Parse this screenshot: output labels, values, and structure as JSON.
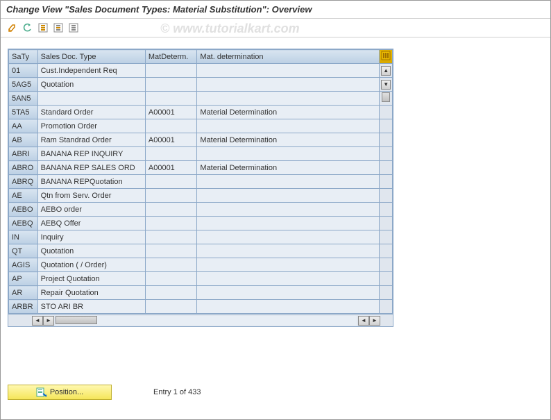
{
  "title": "Change View \"Sales Document Types: Material Substitution\": Overview",
  "watermark": "© www.tutorialkart.com",
  "columns": {
    "saty": "SaTy",
    "doctype": "Sales Doc. Type",
    "matdet": "MatDeterm.",
    "matdetdesc": "Mat. determination"
  },
  "rows": [
    {
      "saty": "01",
      "doctype": "Cust.Independent Req",
      "matdet": "",
      "matdetdesc": ""
    },
    {
      "saty": "5AG5",
      "doctype": "Quotation",
      "matdet": "",
      "matdetdesc": ""
    },
    {
      "saty": "5AN5",
      "doctype": "",
      "matdet": "",
      "matdetdesc": ""
    },
    {
      "saty": "5TA5",
      "doctype": "Standard Order",
      "matdet": "A00001",
      "matdetdesc": "Material Determination"
    },
    {
      "saty": "AA",
      "doctype": "Promotion Order",
      "matdet": "",
      "matdetdesc": ""
    },
    {
      "saty": "AB",
      "doctype": "Ram Standrad Order",
      "matdet": "A00001",
      "matdetdesc": "Material Determination"
    },
    {
      "saty": "ABRI",
      "doctype": "BANANA REP INQUIRY",
      "matdet": "",
      "matdetdesc": ""
    },
    {
      "saty": "ABRO",
      "doctype": "BANANA REP SALES ORD",
      "matdet": "A00001",
      "matdetdesc": "Material Determination"
    },
    {
      "saty": "ABRQ",
      "doctype": "BANANA REPQuotation",
      "matdet": "",
      "matdetdesc": ""
    },
    {
      "saty": "AE",
      "doctype": "Qtn from Serv. Order",
      "matdet": "",
      "matdetdesc": ""
    },
    {
      "saty": "AEBO",
      "doctype": "AEBO order",
      "matdet": "",
      "matdetdesc": ""
    },
    {
      "saty": "AEBQ",
      "doctype": "AEBQ Offer",
      "matdet": "",
      "matdetdesc": ""
    },
    {
      "saty": "IN",
      "doctype": "Inquiry",
      "matdet": "",
      "matdetdesc": ""
    },
    {
      "saty": "QT",
      "doctype": "Quotation",
      "matdet": "",
      "matdetdesc": ""
    },
    {
      "saty": "AGIS",
      "doctype": "Quotation ( / Order)",
      "matdet": "",
      "matdetdesc": ""
    },
    {
      "saty": "AP",
      "doctype": "Project Quotation",
      "matdet": "",
      "matdetdesc": ""
    },
    {
      "saty": "AR",
      "doctype": "Repair Quotation",
      "matdet": "",
      "matdetdesc": ""
    },
    {
      "saty": "ARBR",
      "doctype": "STO ARI BR",
      "matdet": "",
      "matdetdesc": ""
    }
  ],
  "footer": {
    "position_label": "Position...",
    "entry_text": "Entry 1 of 433"
  }
}
